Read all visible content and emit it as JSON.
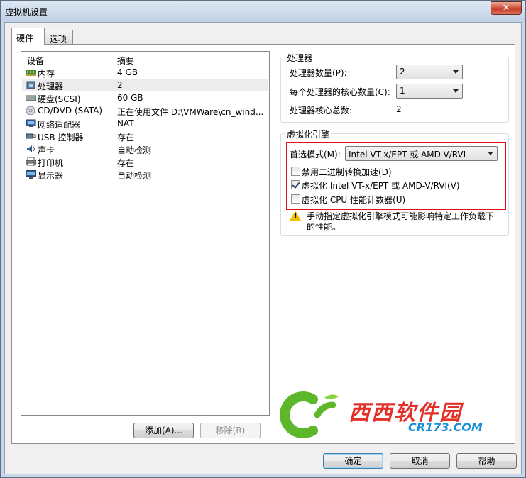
{
  "window": {
    "title": "虚拟机设置",
    "close_glyph": "✕"
  },
  "tabs": [
    {
      "label": "硬件",
      "active": true
    },
    {
      "label": "选项",
      "active": false
    }
  ],
  "device_list": {
    "headers": {
      "device": "设备",
      "summary": "摘要"
    },
    "rows": [
      {
        "icon": "memory-icon",
        "name": "内存",
        "summary": "4 GB"
      },
      {
        "icon": "processor-icon",
        "name": "处理器",
        "summary": "2"
      },
      {
        "icon": "hard-disk-icon",
        "name": "硬盘(SCSI)",
        "summary": "60 GB"
      },
      {
        "icon": "cd-dvd-icon",
        "name": "CD/DVD (SATA)",
        "summary": "正在使用文件 D:\\VMWare\\cn_wind..."
      },
      {
        "icon": "network-adapter-icon",
        "name": "网络适配器",
        "summary": "NAT"
      },
      {
        "icon": "usb-icon",
        "name": "USB 控制器",
        "summary": "存在"
      },
      {
        "icon": "sound-card-icon",
        "name": "声卡",
        "summary": "自动检测"
      },
      {
        "icon": "printer-icon",
        "name": "打印机",
        "summary": "存在"
      },
      {
        "icon": "display-icon",
        "name": "显示器",
        "summary": "自动检测"
      }
    ],
    "selected_index": 1
  },
  "buttons": {
    "add": "添加(A)...",
    "remove": "移除(R)",
    "ok": "确定",
    "cancel": "取消",
    "help": "帮助"
  },
  "processor_group": {
    "title": "处理器",
    "count_label": "处理器数量(P):",
    "count_value": "2",
    "cores_label": "每个处理器的核心数量(C):",
    "cores_value": "1",
    "total_label": "处理器核心总数:",
    "total_value": "2"
  },
  "virtualization_group": {
    "title": "虚拟化引擎",
    "mode_label": "首选模式(M):",
    "mode_value": "Intel VT-x/EPT 或 AMD-V/RVI",
    "options": [
      {
        "label": "禁用二进制转换加速(D)",
        "checked": false
      },
      {
        "label": "虚拟化 Intel VT-x/EPT 或 AMD-V/RVI(V)",
        "checked": true
      },
      {
        "label": "虚拟化 CPU 性能计数器(U)",
        "checked": false
      }
    ],
    "warning_line1": "手动指定虚拟化引擎模式可能影响特定工作负载下",
    "warning_line2": "的性能。"
  },
  "watermark": {
    "brand": "西西软件园",
    "domain": "CR173.COM",
    "logo_text": "Cr"
  },
  "colors": {
    "highlight": "#e01010",
    "warn": "#f2c200",
    "watermark_green": "#5cb82a",
    "watermark_red": "#e2322a",
    "watermark_blue": "#1a8fd6"
  }
}
